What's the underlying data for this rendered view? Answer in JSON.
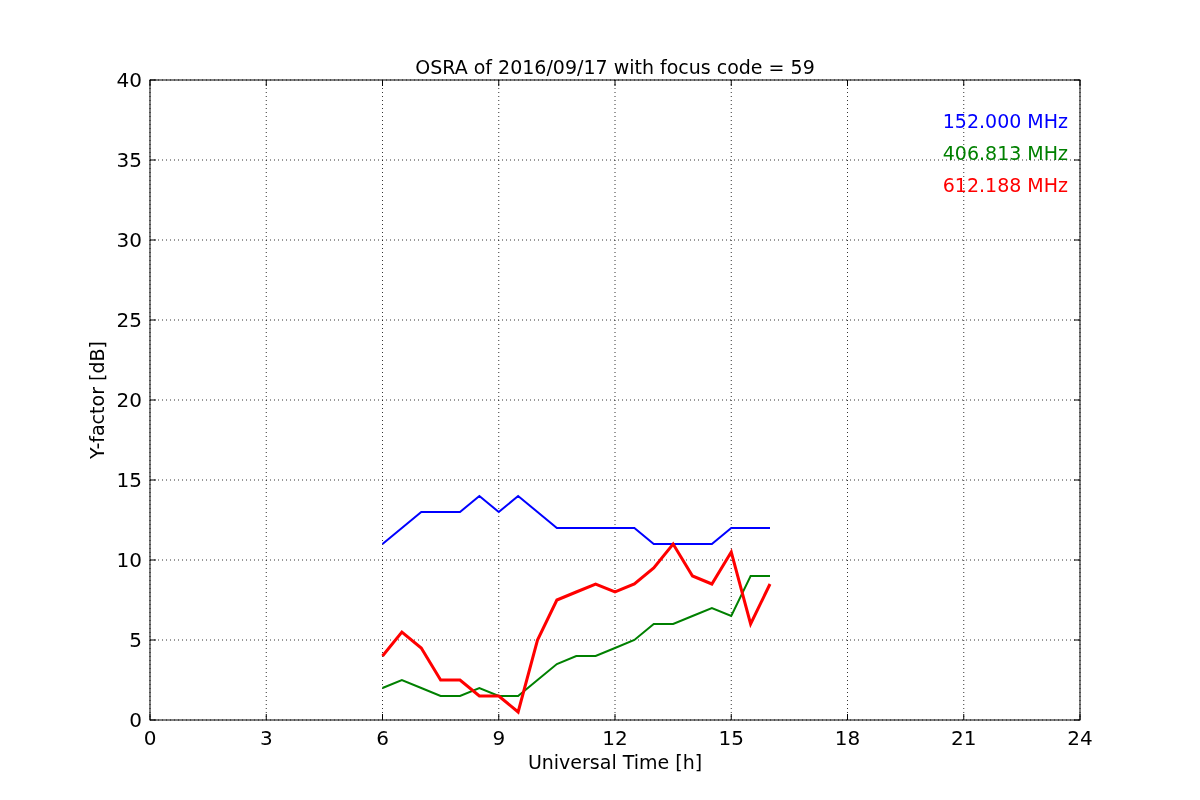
{
  "chart_data": {
    "type": "line",
    "title": "OSRA of 2016/09/17 with focus code = 59",
    "xlabel": "Universal Time [h]",
    "ylabel": "Y-factor [dB]",
    "x": [
      6,
      6.5,
      7,
      7.5,
      8,
      8.5,
      9,
      9.5,
      10,
      10.5,
      11,
      11.5,
      12,
      12.5,
      13,
      13.5,
      14,
      14.5,
      15,
      15.5,
      16
    ],
    "series": [
      {
        "name": "152.000 MHz",
        "color": "#0000ff",
        "values": [
          11,
          12,
          13,
          13,
          13,
          14,
          13,
          14,
          13,
          12,
          12,
          12,
          12,
          12,
          11,
          11,
          11,
          11,
          12,
          12,
          12
        ]
      },
      {
        "name": "406.813 MHz",
        "color": "#008000",
        "values": [
          2,
          2.5,
          2,
          1.5,
          1.5,
          2,
          1.5,
          1.5,
          2.5,
          3.5,
          4,
          4,
          4.5,
          5,
          6,
          6,
          6.5,
          7,
          6.5,
          9,
          9
        ]
      },
      {
        "name": "612.188 MHz",
        "color": "#ff0000",
        "values": [
          4,
          5.5,
          4.5,
          2.5,
          2.5,
          1.5,
          1.5,
          0.5,
          5,
          7.5,
          8,
          8.5,
          8,
          8.5,
          9.5,
          11,
          9,
          8.5,
          10.5,
          6,
          8.5
        ]
      }
    ],
    "xlim": [
      0,
      24
    ],
    "ylim": [
      0,
      40
    ],
    "xticks": [
      0,
      3,
      6,
      9,
      12,
      15,
      18,
      21,
      24
    ],
    "yticks": [
      0,
      5,
      10,
      15,
      20,
      25,
      30,
      35,
      40
    ],
    "grid": true
  }
}
